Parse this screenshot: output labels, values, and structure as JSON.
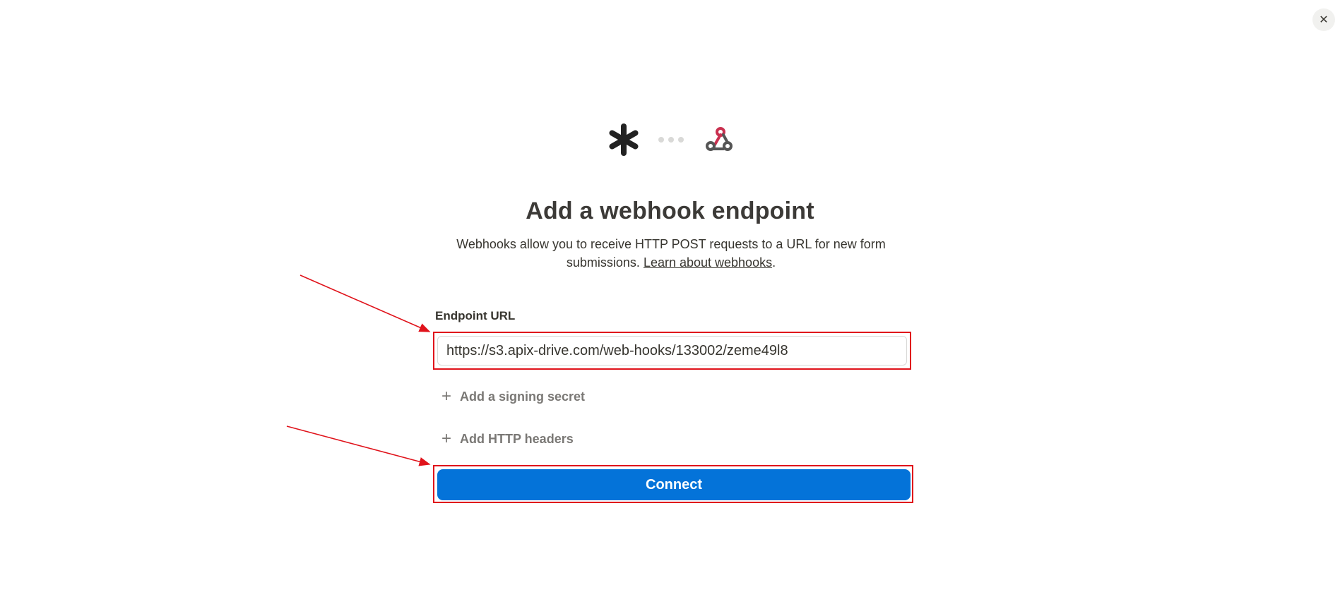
{
  "header": {
    "close_icon": "close-icon",
    "close_glyph": "✕"
  },
  "logos": {
    "left_icon": "asterisk-icon",
    "right_icon": "webhook-icon",
    "accent": "#c9304f"
  },
  "main": {
    "title": "Add a webhook endpoint",
    "description_prefix": "Webhooks allow you to receive HTTP POST requests to a URL for new form submissions. ",
    "learn_link": "Learn about webhooks",
    "description_suffix": "."
  },
  "form": {
    "endpoint_label": "Endpoint URL",
    "endpoint_value": "https://s3.apix-drive.com/web-hooks/133002/zeme49l8",
    "signing_secret_label": "Add a signing secret",
    "http_headers_label": "Add HTTP headers",
    "plus_glyph": "+",
    "connect_label": "Connect"
  },
  "colors": {
    "primary": "#0473d9",
    "annotation": "#e0131b"
  }
}
